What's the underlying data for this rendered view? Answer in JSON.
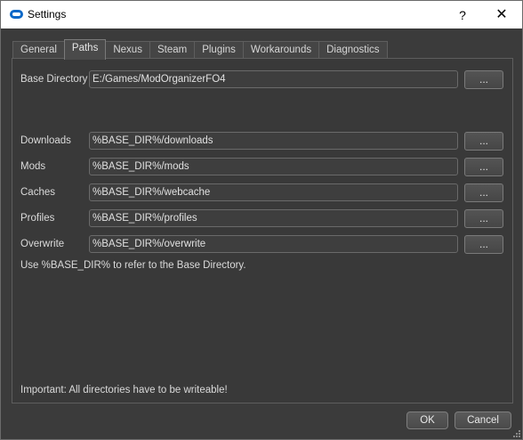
{
  "window": {
    "title": "Settings",
    "help_glyph": "?",
    "close_glyph": "✕",
    "icon": "app-logo-icon"
  },
  "tabs": [
    {
      "label": "General",
      "active": false
    },
    {
      "label": "Paths",
      "active": true
    },
    {
      "label": "Nexus",
      "active": false
    },
    {
      "label": "Steam",
      "active": false
    },
    {
      "label": "Plugins",
      "active": false
    },
    {
      "label": "Workarounds",
      "active": false
    },
    {
      "label": "Diagnostics",
      "active": false
    }
  ],
  "paths": {
    "base": {
      "label": "Base Directory",
      "value": "E:/Games/ModOrganizerFO4",
      "browse": "..."
    },
    "downloads": {
      "label": "Downloads",
      "value": "%BASE_DIR%/downloads",
      "browse": "..."
    },
    "mods": {
      "label": "Mods",
      "value": "%BASE_DIR%/mods",
      "browse": "..."
    },
    "caches": {
      "label": "Caches",
      "value": "%BASE_DIR%/webcache",
      "browse": "..."
    },
    "profiles": {
      "label": "Profiles",
      "value": "%BASE_DIR%/profiles",
      "browse": "..."
    },
    "overwrite": {
      "label": "Overwrite",
      "value": "%BASE_DIR%/overwrite",
      "browse": "..."
    }
  },
  "notes": {
    "base_dir_hint": "Use %BASE_DIR% to refer to the Base Directory.",
    "important": "Important: All directories have to be writeable!"
  },
  "buttons": {
    "ok": "OK",
    "cancel": "Cancel"
  },
  "colors": {
    "background": "#3b3b3b",
    "panel": "#393939",
    "titlebar": "#ffffff",
    "app_icon": "#0a68c8"
  }
}
